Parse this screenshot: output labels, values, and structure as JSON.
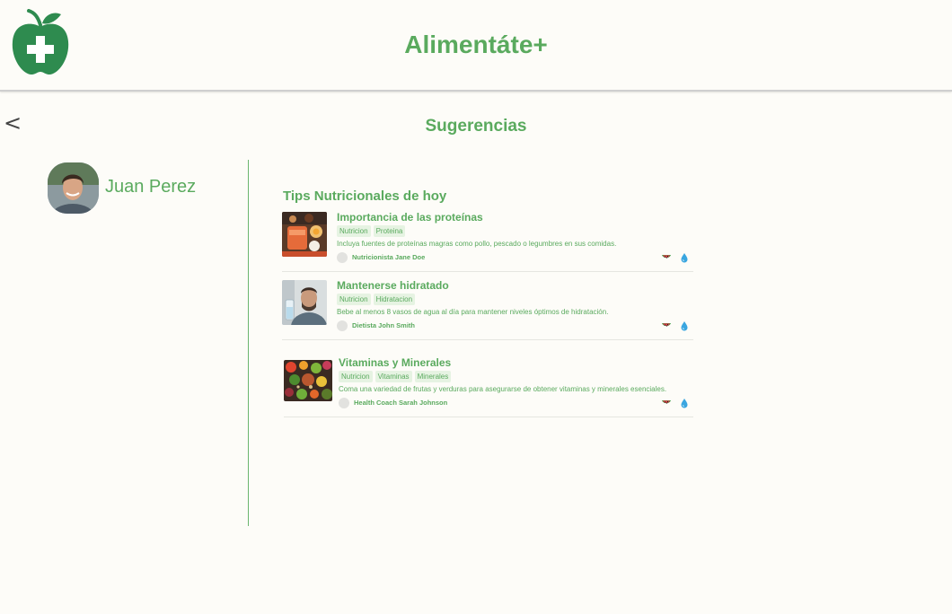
{
  "header": {
    "app_title": "Alimentáte+",
    "logo_icon": "apple-plus-icon",
    "brand_color": "#2e8b4f"
  },
  "nav": {
    "back_label": "<",
    "section_title": "Sugerencias"
  },
  "user": {
    "name": "Juan Perez"
  },
  "tips": {
    "title": "Tips Nutricionales de hoy",
    "items": [
      {
        "title": "Importancia de las proteínas",
        "tags": [
          "Nutricion",
          "Proteina"
        ],
        "description": "Incluya fuentes de proteínas magras como pollo, pescado o legumbres en sus comidas.",
        "author": "Nutricionista Jane Doe",
        "image_icon": "protein-foods-image"
      },
      {
        "title": "Mantenerse hidratado",
        "tags": [
          "Nutricion",
          "Hidratacion"
        ],
        "description": "Bebe al menos 8 vasos de agua al día para mantener niveles óptimos de hidratación.",
        "author": "Dietista John Smith",
        "image_icon": "man-drinking-water-image"
      },
      {
        "title": "Vitaminas y Minerales",
        "tags": [
          "Nutricion",
          "Vitaminas",
          "Minerales"
        ],
        "description": "Coma una variedad de frutas y verduras para asegurarse de obtener vitaminas y minerales esenciales.",
        "author": "Health Coach Sarah Johnson",
        "image_icon": "fruits-vegetables-image"
      }
    ],
    "action_icons": [
      "watermelon-icon",
      "water-drop-icon"
    ]
  },
  "colors": {
    "accent": "#5aaa5e",
    "background": "#fdfcf8",
    "tag_bg": "#e6f3e2"
  }
}
